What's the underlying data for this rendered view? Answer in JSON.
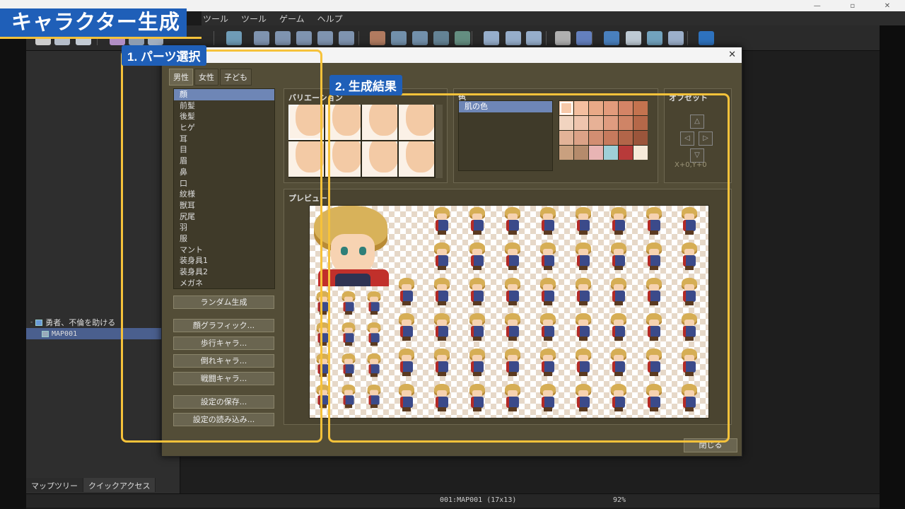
{
  "video": {
    "title": "キャラクター生成",
    "label_parts": "1. パーツ選択",
    "label_result": "2. 生成結果"
  },
  "colors": {
    "accent_blue": "#1f5fb8",
    "highlight_yellow": "#f6c23a",
    "dialog_bg": "#534d37",
    "selection_blue": "#6e86b6"
  },
  "menubar": {
    "items": [
      "ツール",
      "ツール",
      "ゲーム",
      "ヘルプ"
    ]
  },
  "toolbar": {
    "icons": [
      "new-project-icon",
      "open-project-icon",
      "save-project-icon",
      "cut-icon",
      "copy-icon",
      "paste-icon",
      "map-layer-icon",
      "layer-a-icon",
      "layer-b-icon",
      "layer-c-icon",
      "layer-d-icon",
      "layer-e-icon",
      "pencil-icon",
      "rectangle-icon",
      "ellipse-icon",
      "fill-icon",
      "shadow-pen-icon",
      "zoom-in-icon",
      "zoom-out-icon",
      "zoom-actual-icon",
      "database-icon",
      "plugin-icon",
      "sound-icon",
      "event-searcher-icon",
      "resource-manager-icon",
      "character-generator-icon",
      "playtest-icon"
    ]
  },
  "tree": {
    "project": "勇者、不倫を助ける",
    "map": "MAP001"
  },
  "pane_tabs": [
    "マップツリー",
    "クイックアクセス"
  ],
  "status": {
    "map_info": "001:MAP001 (17x13)",
    "zoom": "92%"
  },
  "dialog": {
    "gender_tabs": [
      "男性",
      "女性",
      "子ども"
    ],
    "parts": [
      "顔",
      "前髪",
      "後髪",
      "ヒゲ",
      "耳",
      "目",
      "眉",
      "鼻",
      "口",
      "紋様",
      "獣耳",
      "尻尾",
      "羽",
      "服",
      "マント",
      "装身具1",
      "装身具2",
      "メガネ"
    ],
    "selected_part_index": 0,
    "random_button": "ランダム生成",
    "export_buttons": [
      "顔グラフィック...",
      "歩行キャラ...",
      "倒れキャラ...",
      "戦闘キャラ..."
    ],
    "settings_buttons": [
      "設定の保存...",
      "設定の読み込み..."
    ],
    "variation_label": "バリエーション",
    "color_label": "色",
    "color_items": [
      "肌の色"
    ],
    "palette": [
      "#f7c9a9",
      "#f4bfa0",
      "#e9a987",
      "#e39b7c",
      "#d48466",
      "#c4734f",
      "#f1d4c0",
      "#efc5ae",
      "#e7b196",
      "#df9c80",
      "#cf8466",
      "#b56849",
      "#e2b398",
      "#dca287",
      "#d28e72",
      "#c67a5d",
      "#b26549",
      "#9b553b",
      "#c9a07f",
      "#b58b6c",
      "#e8b4b4",
      "#9fcfd8",
      "#b83a3a",
      "#f6ead9"
    ],
    "offset_label": "オフセット",
    "offset_text": "X+0,Y+0",
    "preview_label": "プレビュー",
    "close_button": "閉じる"
  }
}
